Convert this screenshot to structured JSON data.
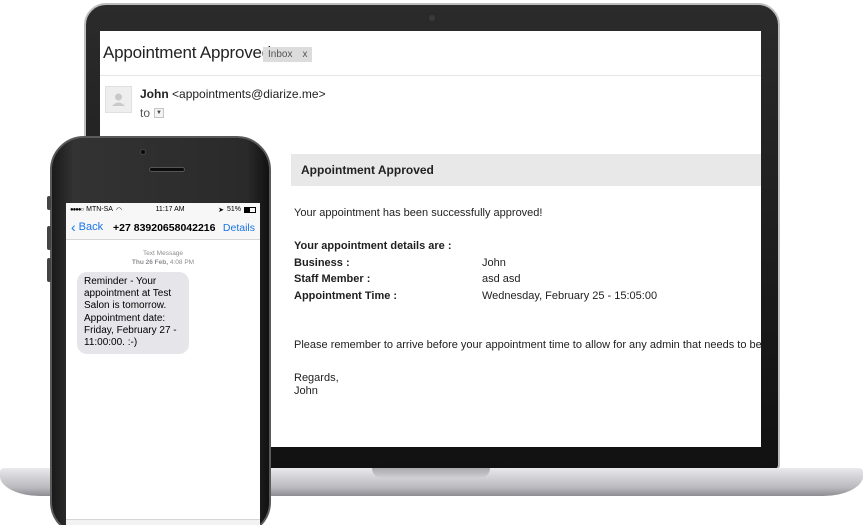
{
  "email": {
    "subject": "Appointment Approved",
    "label": "Inbox",
    "label_close": "x",
    "sender_name": "John",
    "sender_email": "<appointments@diarize.me>",
    "to_label": "to",
    "card_title": "Appointment Approved",
    "intro": "Your appointment has been successfully approved!",
    "details_heading": "Your appointment details are :",
    "details": [
      {
        "label": "Business :",
        "value": "John"
      },
      {
        "label": "Staff Member :",
        "value": "asd asd"
      },
      {
        "label": "Appointment Time :",
        "value": "Wednesday, February 25 - 15:05:00"
      }
    ],
    "reminder": "Please remember to arrive before your appointment time to allow for any admin that needs to be done.",
    "signoff": "Regards,",
    "signature": "John"
  },
  "phone": {
    "carrier": "MTN-SA",
    "time": "11:17 AM",
    "battery": "51%",
    "back_label": "Back",
    "contact_number": "+27 83920658042216",
    "details_label": "Details",
    "message_type": "Text Message",
    "message_timestamp_day": "Thu 26 Feb,",
    "message_timestamp_time": "4:08 PM",
    "message_lines": [
      "Reminder - Your",
      "appointment at Test",
      "Salon is tomorrow.",
      "Appointment date:",
      "Friday, February 27 -",
      "11:00:00. :-)"
    ]
  }
}
